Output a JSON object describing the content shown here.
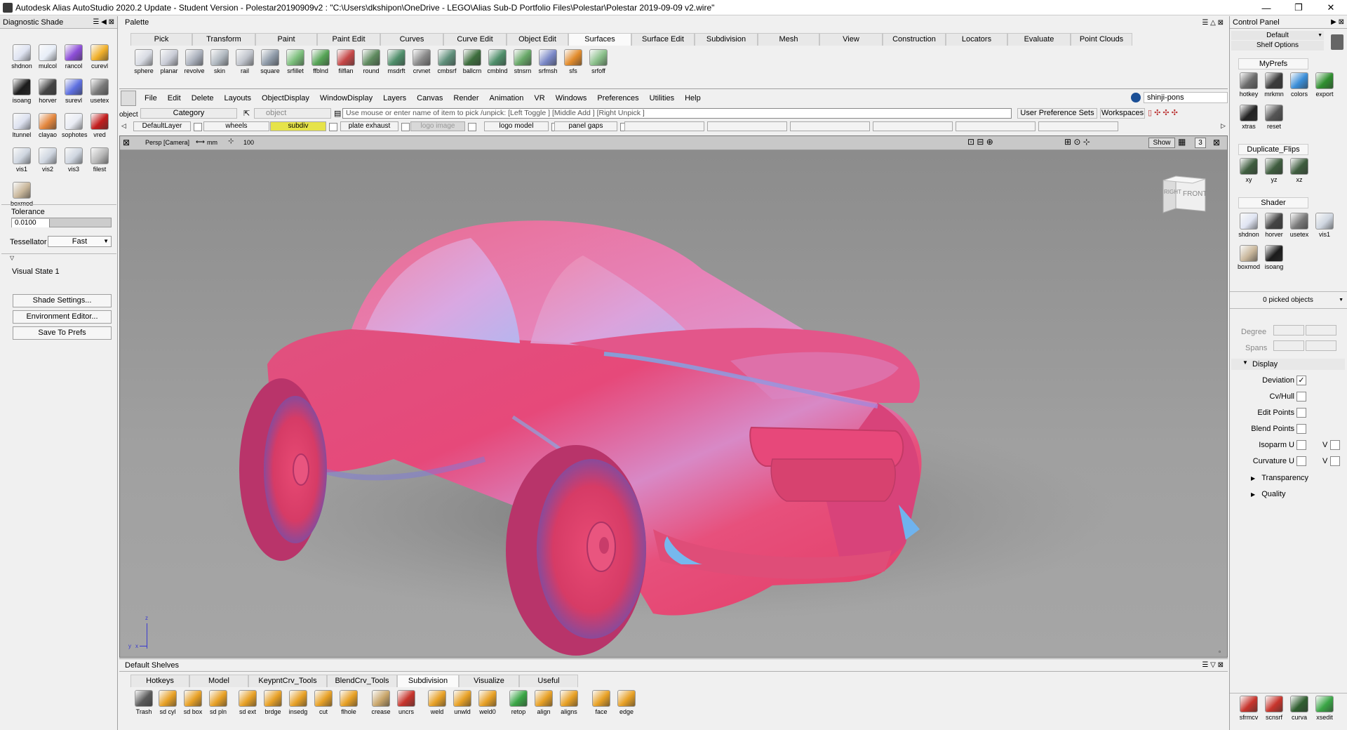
{
  "window": {
    "title": "Autodesk Alias AutoStudio 2020.2 Update - Student Version  - Polestar20190909v2 : \"C:\\Users\\dkshipon\\OneDrive - LEGO\\Alias Sub-D Portfolio Files\\Polestar\\Polestar 2019-09-09 v2.wire\"",
    "controls": [
      "—",
      "❐",
      "✕"
    ]
  },
  "diagnostic_shade": {
    "header": "Diagnostic Shade",
    "tools": [
      {
        "label": "shdnon",
        "color": "#dfe4f2"
      },
      {
        "label": "mulcol",
        "color": "#e8eef8"
      },
      {
        "label": "rancol",
        "color": "#8d4ed8"
      },
      {
        "label": "curevl",
        "color": "#f1b02a"
      },
      {
        "label": "isoang",
        "color": "#1b1b1b"
      },
      {
        "label": "horver",
        "color": "#444444"
      },
      {
        "label": "surevl",
        "color": "#5d6fe0"
      },
      {
        "label": "usetex",
        "color": "#7a7a7a"
      },
      {
        "label": "ltunnel",
        "color": "#dde2f0"
      },
      {
        "label": "clayao",
        "color": "#e3863d"
      },
      {
        "label": "sophotes",
        "color": "#e9ecf4"
      },
      {
        "label": "vred",
        "color": "#c21d1d"
      },
      {
        "label": "vis1",
        "color": "#cfd6e0"
      },
      {
        "label": "vis2",
        "color": "#cfd6e0"
      },
      {
        "label": "vis3",
        "color": "#cfd6e0"
      },
      {
        "label": "filest",
        "color": "#b8b8b8"
      },
      {
        "label": "boxmod",
        "color": "#c9b79b"
      }
    ],
    "tolerance_label": "Tolerance",
    "tolerance_value": "0.0100",
    "tessellator_label": "Tessellator",
    "tessellator_value": "Fast",
    "visual_state": "Visual State 1",
    "buttons": [
      "Shade Settings...",
      "Environment Editor...",
      "Save To Prefs"
    ]
  },
  "palette": {
    "header": "Palette",
    "tabs": [
      "Pick",
      "Transform",
      "Paint",
      "Paint Edit",
      "Curves",
      "Curve Edit",
      "Object Edit",
      "Surfaces",
      "Surface Edit",
      "Subdivision",
      "Mesh",
      "View",
      "Construction",
      "Locators",
      "Evaluate",
      "Point Clouds"
    ],
    "active_tab": "Surfaces",
    "tools": [
      {
        "label": "sphere",
        "color": "#d8dbe3"
      },
      {
        "label": "planar",
        "color": "#c9ccd6"
      },
      {
        "label": "revolve",
        "color": "#aab0bc"
      },
      {
        "label": "skin",
        "color": "#b0b8c0"
      },
      {
        "label": "rail",
        "color": "#c0c4cc"
      },
      {
        "label": "square",
        "color": "#8e9aa8"
      },
      {
        "label": "srfillet",
        "color": "#7bbf7b"
      },
      {
        "label": "ffblnd",
        "color": "#56a456"
      },
      {
        "label": "filflan",
        "color": "#c64747"
      },
      {
        "label": "round",
        "color": "#5e8a5e"
      },
      {
        "label": "msdrft",
        "color": "#4f8e6a"
      },
      {
        "label": "crvnet",
        "color": "#8a8a8a"
      },
      {
        "label": "cmbsrf",
        "color": "#5f8f7a"
      },
      {
        "label": "ballcrn",
        "color": "#3d6e3d"
      },
      {
        "label": "cmblnd",
        "color": "#4f8f6a"
      },
      {
        "label": "stnsrn",
        "color": "#67a767"
      },
      {
        "label": "srfmsh",
        "color": "#7a88c8"
      },
      {
        "label": "sfs",
        "color": "#e28b2b"
      },
      {
        "label": "srfoff",
        "color": "#8ac08a"
      }
    ]
  },
  "menubar": {
    "items": [
      "File",
      "Edit",
      "Delete",
      "Layouts",
      "ObjectDisplay",
      "WindowDisplay",
      "Layers",
      "Canvas",
      "Render",
      "Animation",
      "VR",
      "Windows",
      "Preferences",
      "Utilities",
      "Help"
    ],
    "user": "shinji-pons"
  },
  "promptline": {
    "object_label": "object",
    "category_label": "Category",
    "pick_field": "object",
    "prompt_text": "Use mouse or enter name of item to pick /unpick: [Left Toggle ] [Middle Add ] [Right Unpick ]",
    "user_pref_sets": "User Preference Sets",
    "workspaces": "Workspaces"
  },
  "layers": [
    "DefaultLayer",
    "wheels",
    "subdiv",
    "plate exhaust",
    "logo image",
    "logo model",
    "panel gaps"
  ],
  "viewport": {
    "camera": "Persp [Camera]",
    "units": "mm",
    "zoom": "100",
    "show_button": "Show",
    "show_count": "3",
    "viewcube_right": "RIGHT",
    "viewcube_front": "FRONT",
    "axis_z": "z",
    "axis_y": "y",
    "axis_x": "x"
  },
  "shelves": {
    "header": "Default Shelves",
    "tabs": [
      "Hotkeys",
      "Model",
      "KeypntCrv_Tools",
      "BlendCrv_Tools",
      "Subdivision",
      "Visualize",
      "Useful"
    ],
    "active_tab": "Subdivision",
    "tools": [
      {
        "label": "Trash",
        "color": "#5a5a5a"
      },
      {
        "label": "sd cyl",
        "color": "#e8a126"
      },
      {
        "label": "sd box",
        "color": "#e8a126"
      },
      {
        "label": "sd pln",
        "color": "#e8a126"
      },
      {
        "label": "sd ext",
        "color": "#e8a126"
      },
      {
        "label": "brdge",
        "color": "#e8a126"
      },
      {
        "label": "insedg",
        "color": "#e8a126"
      },
      {
        "label": "cut",
        "color": "#e8a126"
      },
      {
        "label": "flhole",
        "color": "#e8a126"
      },
      {
        "label": "crease",
        "color": "#c9a66b"
      },
      {
        "label": "uncrs",
        "color": "#c8342c"
      },
      {
        "label": "weld",
        "color": "#e8a126"
      },
      {
        "label": "unwld",
        "color": "#e8a126"
      },
      {
        "label": "weld0",
        "color": "#e8a126"
      },
      {
        "label": "retop",
        "color": "#3aa646"
      },
      {
        "label": "align",
        "color": "#e8a126"
      },
      {
        "label": "aligns",
        "color": "#e8a126"
      },
      {
        "label": "face",
        "color": "#e8a126"
      },
      {
        "label": "edge",
        "color": "#e8a126"
      }
    ]
  },
  "control_panel": {
    "header": "Control Panel",
    "default_label": "Default",
    "shelf_options": "Shelf Options",
    "myprefs_header": "MyPrefs",
    "myprefs": [
      {
        "label": "hotkey",
        "color": "#6a6a6a"
      },
      {
        "label": "mrkmn",
        "color": "#3b3b3b"
      },
      {
        "label": "colors",
        "color": "#3a8ed8"
      },
      {
        "label": "export",
        "color": "#2f8f2f"
      },
      {
        "label": "xtras",
        "color": "#222222"
      },
      {
        "label": "reset",
        "color": "#555555"
      }
    ],
    "dup_header": "Duplicate_Flips",
    "dups": [
      {
        "label": "xy",
        "color": "#3e5d3e"
      },
      {
        "label": "yz",
        "color": "#3e5d3e"
      },
      {
        "label": "xz",
        "color": "#3e5d3e"
      }
    ],
    "shader_header": "Shader",
    "shaders": [
      {
        "label": "shdnon",
        "color": "#dfe4f2"
      },
      {
        "label": "horver",
        "color": "#444444"
      },
      {
        "label": "usetex",
        "color": "#7a7a7a"
      },
      {
        "label": "vis1",
        "color": "#cfd6e0"
      },
      {
        "label": "boxmod",
        "color": "#c9b79b"
      },
      {
        "label": "isoang",
        "color": "#1b1b1b"
      }
    ],
    "picked": "0 picked objects",
    "degree": "Degree",
    "spans": "Spans",
    "display": "Display",
    "deviation": "Deviation",
    "cvhull": "Cv/Hull",
    "editpoints": "Edit Points",
    "blendpoints": "Blend Points",
    "isoparm": "Isoparm U",
    "curvature": "Curvature U",
    "v": "V",
    "transparency": "Transparency",
    "quality": "Quality",
    "bottom_tools": [
      {
        "label": "sfrmcv",
        "color": "#c8342c"
      },
      {
        "label": "scnsrf",
        "color": "#c8342c"
      },
      {
        "label": "curva",
        "color": "#2f5e2f"
      },
      {
        "label": "xsedit",
        "color": "#3aa646"
      }
    ]
  },
  "colors": {
    "viewport_top": "#8b8b8b",
    "viewport_bottom": "#a3a3a3",
    "car_pink": "#e84a74",
    "car_blue": "#6fb3ee",
    "active_layer": "#e6e34a"
  }
}
